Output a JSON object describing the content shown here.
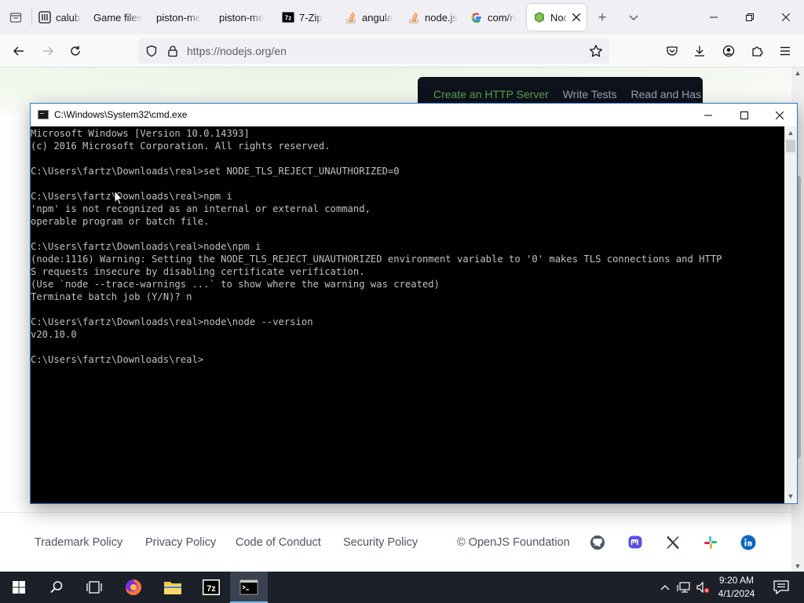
{
  "browser": {
    "tabs": [
      {
        "title": "calubj",
        "icon": "calubj-favicon-icon",
        "active": false
      },
      {
        "title": "Game files",
        "icon": "",
        "active": false
      },
      {
        "title": "piston-me",
        "icon": "",
        "active": false
      },
      {
        "title": "piston-me",
        "icon": "",
        "active": false
      },
      {
        "title": "7-Zip",
        "icon": "7zip-favicon-icon",
        "active": false
      },
      {
        "title": "angula",
        "icon": "stackoverflow-favicon-icon",
        "active": false
      },
      {
        "title": "node.js",
        "icon": "stackoverflow-favicon-icon",
        "active": false
      },
      {
        "title": "com/n",
        "icon": "google-favicon-icon",
        "active": false
      },
      {
        "title": "Nod",
        "icon": "nodejs-favicon-icon",
        "active": true
      }
    ],
    "url": "https://nodejs.org/en"
  },
  "webpage": {
    "code_tabs": [
      "Create an HTTP Server",
      "Write Tests",
      "Read and Has"
    ],
    "footer_links": [
      "Trademark Policy",
      "Privacy Policy",
      "Code of Conduct",
      "Security Policy",
      "© OpenJS Foundation"
    ],
    "social_icons": [
      "github-icon",
      "mastodon-icon",
      "x-twitter-icon",
      "slack-icon",
      "linkedin-icon"
    ]
  },
  "cmd": {
    "title": "C:\\Windows\\System32\\cmd.exe",
    "lines": [
      "Microsoft Windows [Version 10.0.14393]",
      "(c) 2016 Microsoft Corporation. All rights reserved.",
      "",
      "C:\\Users\\fartz\\Downloads\\real>set NODE_TLS_REJECT_UNAUTHORIZED=0",
      "",
      "C:\\Users\\fartz\\Downloads\\real>npm i",
      "'npm' is not recognized as an internal or external command,",
      "operable program or batch file.",
      "",
      "C:\\Users\\fartz\\Downloads\\real>node\\npm i",
      "(node:1116) Warning: Setting the NODE_TLS_REJECT_UNAUTHORIZED environment variable to '0' makes TLS connections and HTTP",
      "S requests insecure by disabling certificate verification.",
      "(Use `node --trace-warnings ...` to show where the warning was created)",
      "Terminate batch job (Y/N)? n",
      "",
      "C:\\Users\\fartz\\Downloads\\real>node\\node --version",
      "v20.10.0",
      "",
      "C:\\Users\\fartz\\Downloads\\real>"
    ]
  },
  "taskbar": {
    "time": "9:20 AM",
    "date": "4/1/2024",
    "apps": [
      "firefox-icon",
      "file-explorer-icon",
      "7zip-icon",
      "cmd-icon"
    ]
  }
}
